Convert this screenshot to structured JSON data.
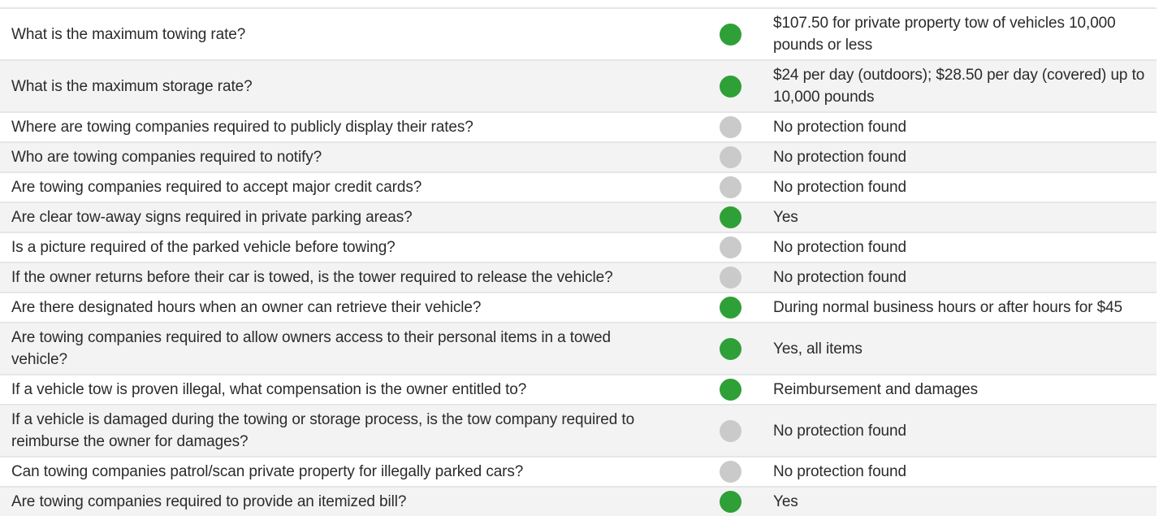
{
  "colors": {
    "yes": "#2ea037",
    "no": "#cacaca"
  },
  "rows": [
    {
      "question": "What is the maximum towing rate?",
      "status": "green",
      "answer": "$107.50 for private property tow of vehicles 10,000 pounds or less"
    },
    {
      "question": "What is the maximum storage rate?",
      "status": "green",
      "answer": "$24 per day (outdoors); $28.50 per day (covered) up to 10,000 pounds"
    },
    {
      "question": "Where are towing companies required to publicly display their rates?",
      "status": "gray",
      "answer": "No protection found"
    },
    {
      "question": "Who are towing companies required to notify?",
      "status": "gray",
      "answer": "No protection found"
    },
    {
      "question": "Are towing companies required to accept major credit cards?",
      "status": "gray",
      "answer": "No protection found"
    },
    {
      "question": "Are clear tow-away signs required in private parking areas?",
      "status": "green",
      "answer": "Yes"
    },
    {
      "question": "Is a picture required of the parked vehicle before towing?",
      "status": "gray",
      "answer": "No protection found"
    },
    {
      "question": "If the owner returns before their car is towed, is the tower required to release the vehicle?",
      "status": "gray",
      "answer": "No protection found"
    },
    {
      "question": "Are there designated hours when an owner can retrieve their vehicle?",
      "status": "green",
      "answer": "During normal business hours or after hours for $45"
    },
    {
      "question": "Are towing companies required to allow owners access to their personal items in a towed vehicle?",
      "status": "green",
      "answer": "Yes, all items"
    },
    {
      "question": "If a vehicle tow is proven illegal, what compensation is the owner entitled to?",
      "status": "green",
      "answer": "Reimbursement and damages"
    },
    {
      "question": "If a vehicle is damaged during the towing or storage process, is the tow company required to reimburse the owner for damages?",
      "status": "gray",
      "answer": "No protection found"
    },
    {
      "question": "Can towing companies patrol/scan private property for illegally parked cars?",
      "status": "gray",
      "answer": "No protection found"
    },
    {
      "question": "Are towing companies required to provide an itemized bill?",
      "status": "green",
      "answer": "Yes"
    }
  ]
}
